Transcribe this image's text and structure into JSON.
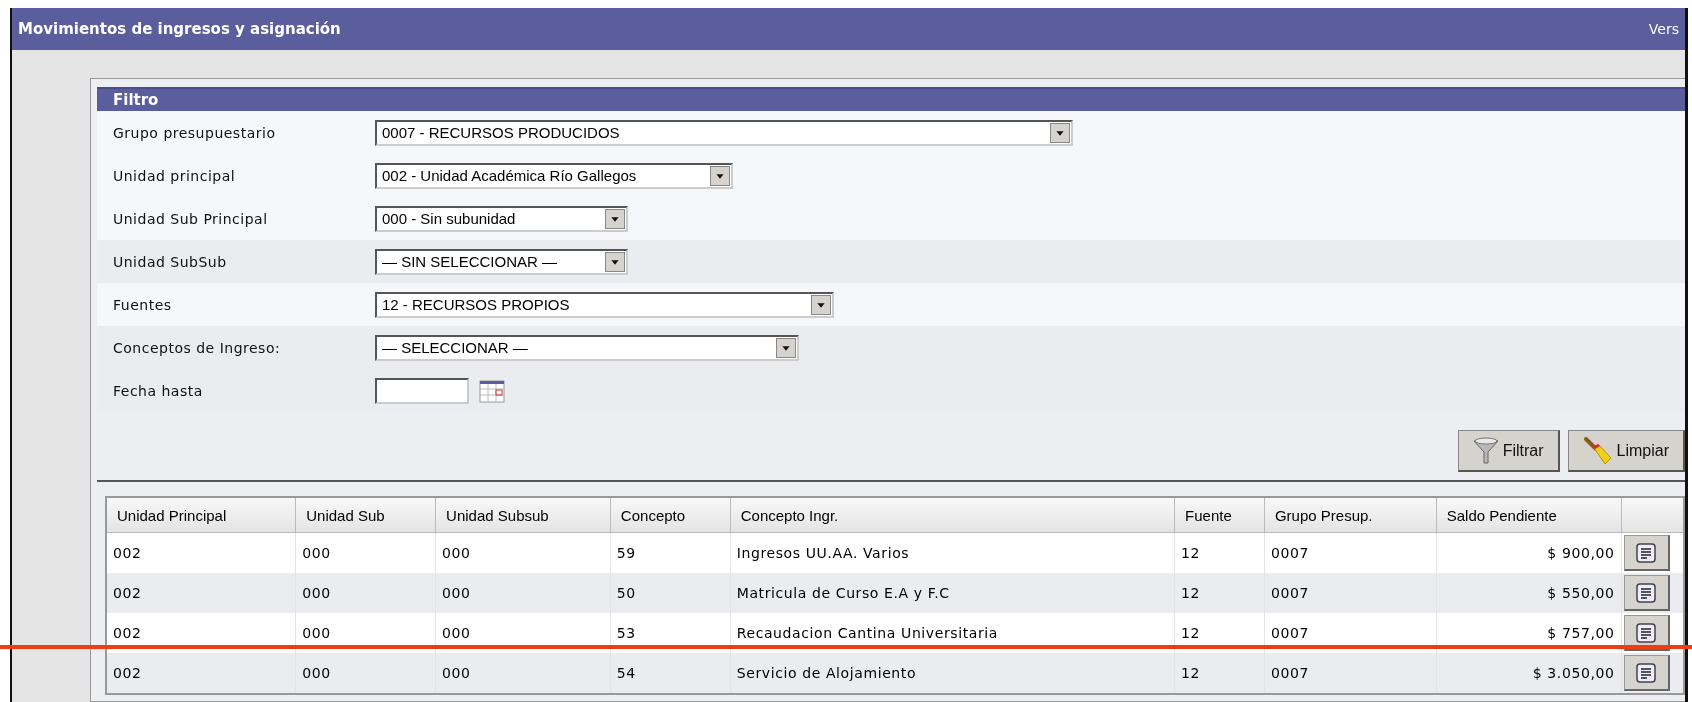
{
  "window": {
    "title": "Movimientos de ingresos y asignación",
    "version_label": "Vers"
  },
  "filter": {
    "title": "Filtro",
    "fields": [
      {
        "kind": "select",
        "label": "Grupo presupuestario",
        "value": "0007 - RECURSOS PRODUCIDOS"
      },
      {
        "kind": "select",
        "label": "Unidad principal",
        "value": "002 - Unidad Académica Río Gallegos"
      },
      {
        "kind": "select",
        "label": "Unidad Sub Principal",
        "value": "000 - Sin subunidad"
      },
      {
        "kind": "select",
        "label": "Unidad SubSub",
        "value": "— SIN SELECCIONAR —"
      },
      {
        "kind": "select",
        "label": "Fuentes",
        "value": "12 - RECURSOS PROPIOS"
      },
      {
        "kind": "select",
        "label": "Conceptos de Ingreso:",
        "value": "— SELECCIONAR —"
      },
      {
        "kind": "date",
        "label": "Fecha hasta"
      }
    ],
    "buttons": [
      {
        "kind": "filter",
        "label": "Filtrar"
      },
      {
        "kind": "clear",
        "label": "Limpiar"
      }
    ]
  },
  "table": {
    "columns": [
      "Unidad Principal",
      "Unidad Sub",
      "Unidad Subsub",
      "Concepto",
      "Concepto Ingr.",
      "Fuente",
      "Grupo Presup.",
      "Saldo Pendiente"
    ],
    "rows": [
      [
        "002",
        "000",
        "000",
        "59",
        "Ingresos UU.AA. Varios",
        "12",
        "0007",
        "$ 900,00"
      ],
      [
        "002",
        "000",
        "000",
        "50",
        "Matricula de Curso E.A y F.C",
        "12",
        "0007",
        "$ 550,00"
      ],
      [
        "002",
        "000",
        "000",
        "53",
        "Recaudacion Cantina Universitaria",
        "12",
        "0007",
        "$ 757,00"
      ],
      [
        "002",
        "000",
        "000",
        "54",
        "Servicio de Alojamiento",
        "12",
        "0007",
        "$ 3.050,00"
      ]
    ]
  },
  "annotation_line": true
}
